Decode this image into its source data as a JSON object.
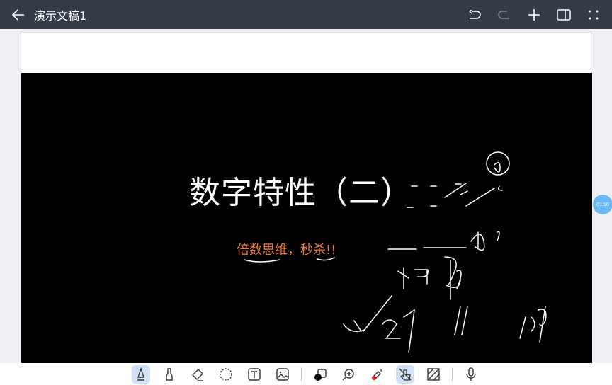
{
  "header": {
    "title": "演示文稿1"
  },
  "slide": {
    "title": "数字特性（二）",
    "subtitle": "倍数思维，秒杀!!"
  },
  "timer": {
    "label": "01:10"
  },
  "toolbar": {
    "tools": [
      "pen",
      "highlighter",
      "eraser",
      "lasso-select",
      "text",
      "image",
      "color",
      "zoom",
      "laser-pointer",
      "touch-draw",
      "background-pattern",
      "microphone"
    ],
    "active": [
      "pen",
      "touch-draw"
    ]
  },
  "colors": {
    "header_bg": "#333c48",
    "accent": "#ef7a3d",
    "timer": "#6cb8f4"
  }
}
